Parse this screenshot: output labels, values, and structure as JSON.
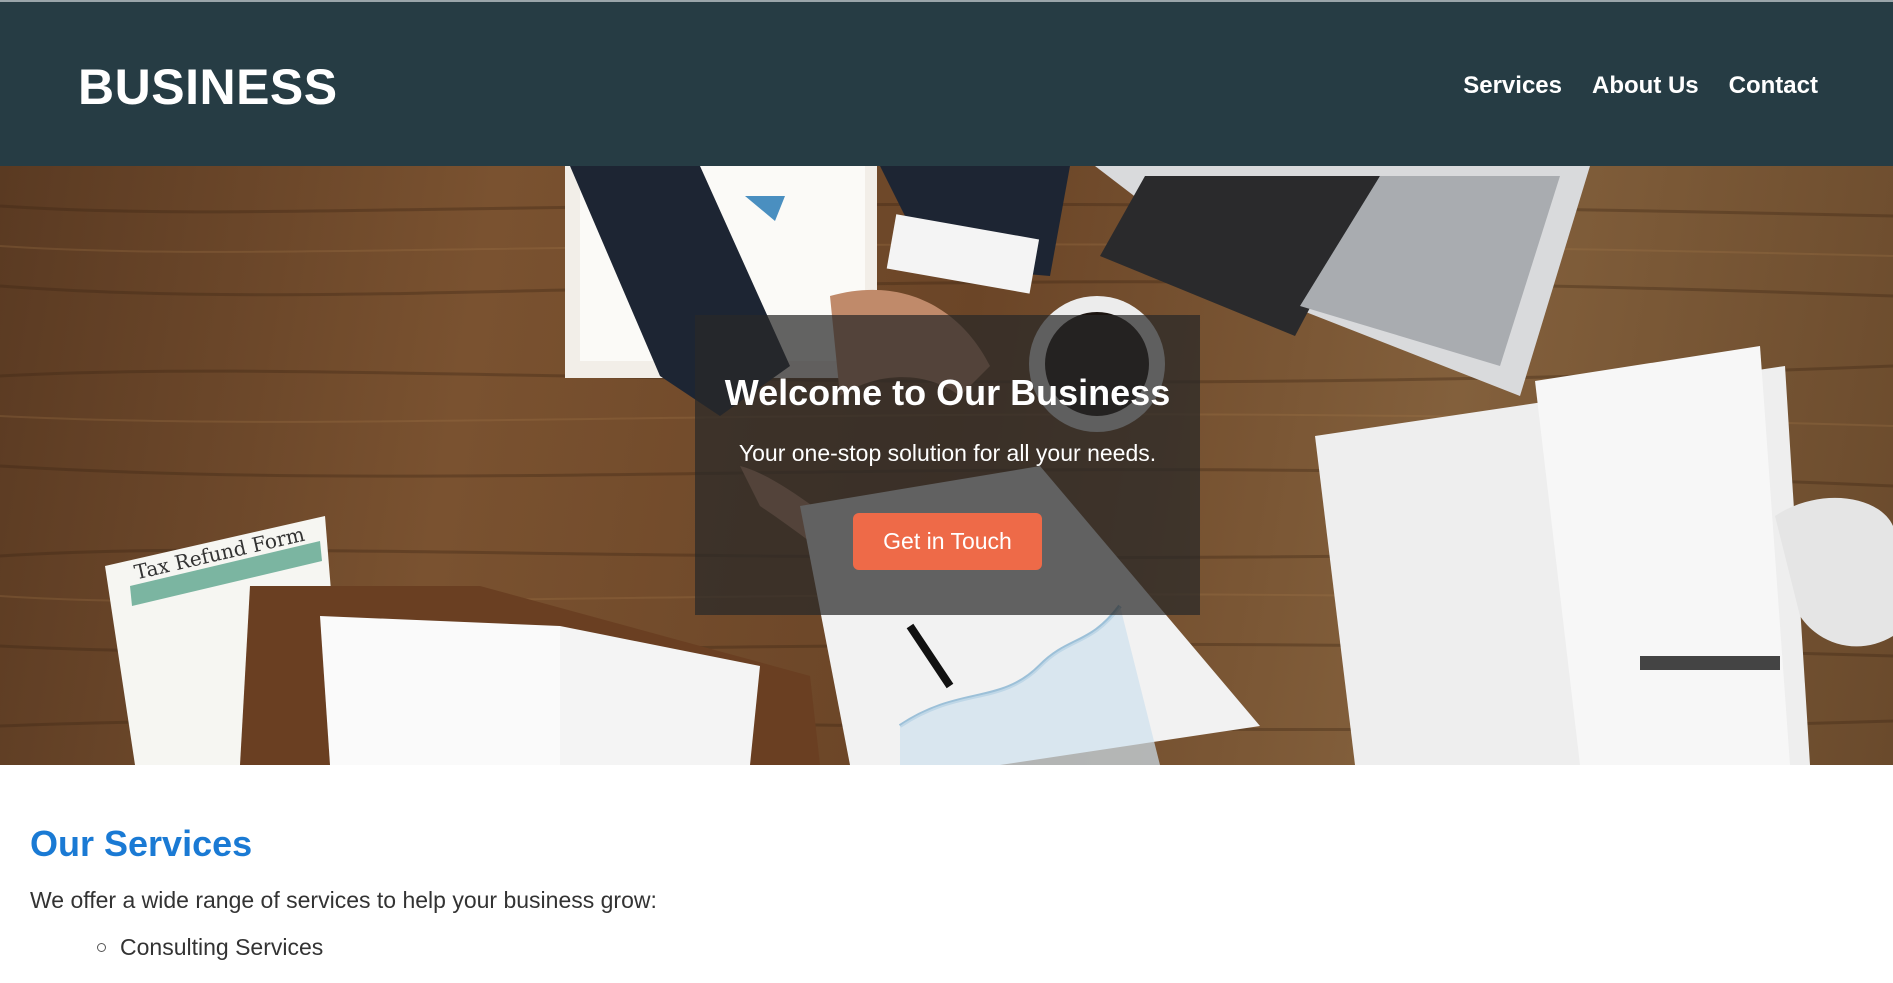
{
  "header": {
    "logo": "BUSINESS",
    "nav": [
      {
        "label": "Services"
      },
      {
        "label": "About Us"
      },
      {
        "label": "Contact"
      }
    ]
  },
  "hero": {
    "title": "Welcome to Our Business",
    "subtitle": "Your one-stop solution for all your needs.",
    "cta_label": "Get in Touch",
    "image_text": {
      "form_label": "Tax Refund Form"
    }
  },
  "services": {
    "title": "Our Services",
    "intro": "We offer a wide range of services to help your business grow:",
    "items": [
      {
        "label": "Consulting Services"
      }
    ]
  },
  "colors": {
    "header_bg": "#263c44",
    "cta": "#ee6a48",
    "heading_blue": "#1a7ad4"
  }
}
